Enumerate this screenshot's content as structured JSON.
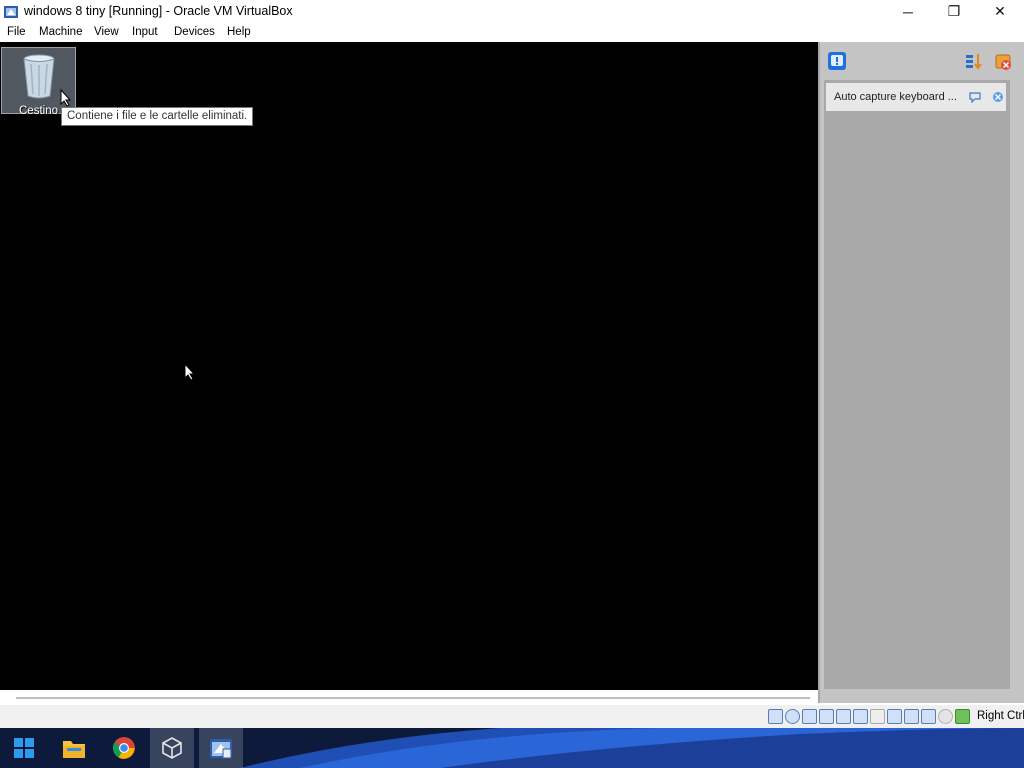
{
  "window": {
    "title": "windows 8 tiny [Running] - Oracle VM VirtualBox",
    "controls": {
      "minimize": "─",
      "maximize": "❐",
      "close": "✕"
    }
  },
  "menu": {
    "items": [
      "File",
      "Machine",
      "View",
      "Input",
      "Devices",
      "Help"
    ]
  },
  "guest": {
    "desktop_icon_label": "Cestino",
    "tooltip": "Contiene i file e le cartelle eliminati."
  },
  "notification": {
    "message": "Auto capture keyboard ..."
  },
  "statusbar": {
    "host_key": "Right Ctrl",
    "icons": [
      "hard-disk-icon",
      "optical-disk-icon",
      "audio-icon",
      "network-icon",
      "usb-icon",
      "shared-folders-icon",
      "display-icon",
      "video-capture-icon",
      "recording-icon",
      "cpu-icon",
      "mouse-integration-icon",
      "keyboard-icon"
    ]
  },
  "taskbar": {
    "items": [
      "windows-start-icon",
      "file-explorer-icon",
      "chrome-icon",
      "virtualbox-manager-icon",
      "virtualbox-vm-icon"
    ]
  },
  "colors": {
    "vm_background": "#000000",
    "panel_background": "#a9a9a9",
    "taskbar_background": "#0d1a3b",
    "accent_blue": "#1f6fe0"
  }
}
